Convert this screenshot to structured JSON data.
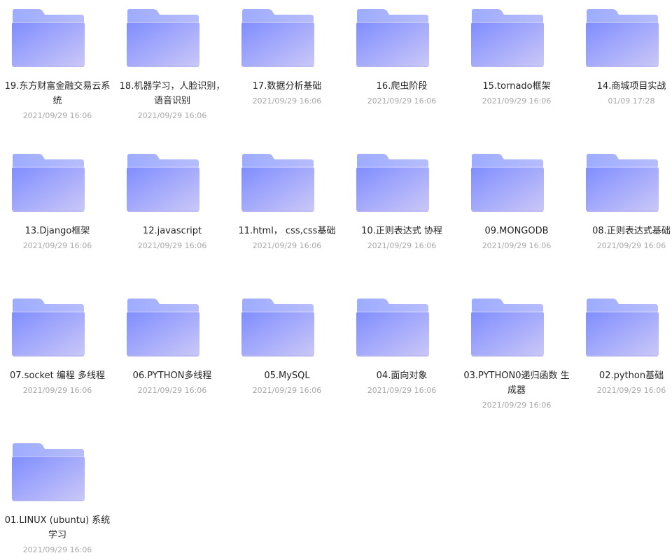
{
  "folders": [
    {
      "name": "19.东方财富金融交易云系统",
      "date": "2021/09/29 16:06"
    },
    {
      "name": "18.机器学习，人脸识别，语音识别",
      "date": "2021/09/29 16:06"
    },
    {
      "name": "17.数据分析基础",
      "date": "2021/09/29 16:06"
    },
    {
      "name": "16.爬虫阶段",
      "date": "2021/09/29 16:06"
    },
    {
      "name": "15.tornado框架",
      "date": "2021/09/29 16:06"
    },
    {
      "name": "14.商城项目实战",
      "date": "01/09 17:28"
    },
    {
      "name": "13.Django框架",
      "date": "2021/09/29 16:06"
    },
    {
      "name": "12.javascript",
      "date": "2021/09/29 16:06"
    },
    {
      "name": "11.html， css,css基础",
      "date": "2021/09/29 16:06"
    },
    {
      "name": "10.正则表达式 协程",
      "date": "2021/09/29 16:06"
    },
    {
      "name": "09.MONGODB",
      "date": "2021/09/29 16:06"
    },
    {
      "name": "08.正则表达式基础",
      "date": "2021/09/29 16:06"
    },
    {
      "name": "07.socket 编程 多线程",
      "date": "2021/09/29 16:06"
    },
    {
      "name": "06.PYTHON多线程",
      "date": "2021/09/29 16:06"
    },
    {
      "name": "05.MySQL",
      "date": "2021/09/29 16:06"
    },
    {
      "name": "04.面向对象",
      "date": "2021/09/29 16:06"
    },
    {
      "name": "03.PYTHON0递归函数 生成器",
      "date": "2021/09/29 16:06"
    },
    {
      "name": "02.python基础",
      "date": "2021/09/29 16:06"
    },
    {
      "name": "01.LINUX (ubuntu) 系统学习",
      "date": "2021/09/29 16:06"
    }
  ],
  "colors": {
    "folder_back": "#a9b6ff",
    "folder_front_start": "#7f8dff",
    "folder_front_end": "#cbc8f7",
    "name_text": "#252525",
    "date_text": "#a7a7a7"
  },
  "icon": "folder-icon"
}
